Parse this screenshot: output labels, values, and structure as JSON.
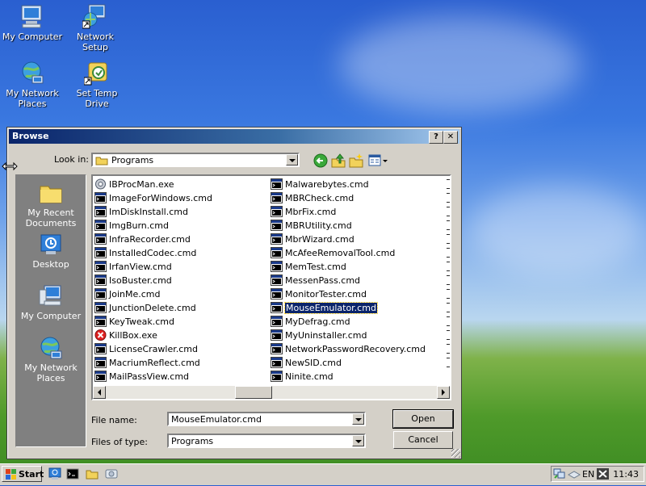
{
  "desktop": {
    "icons": [
      {
        "label": "My Computer"
      },
      {
        "label": "Network Setup"
      },
      {
        "label": "My Network Places"
      },
      {
        "label": "Set Temp Drive"
      }
    ]
  },
  "dialog": {
    "title": "Browse",
    "help_btn": "?",
    "close_btn": "✕",
    "look_in_label": "Look in:",
    "look_in_value": "Programs",
    "places": [
      {
        "label": "My Recent Documents"
      },
      {
        "label": "Desktop"
      },
      {
        "label": "My Computer"
      },
      {
        "label": "My Network Places"
      }
    ],
    "files_col1": [
      "IBProcMan.exe",
      "ImageForWindows.cmd",
      "ImDiskInstall.cmd",
      "ImgBurn.cmd",
      "InfraRecorder.cmd",
      "InstalledCodec.cmd",
      "IrfanView.cmd",
      "IsoBuster.cmd",
      "JoinMe.cmd",
      "JunctionDelete.cmd",
      "KeyTweak.cmd",
      "KillBox.exe",
      "LicenseCrawler.cmd",
      "MacriumReflect.cmd",
      "MailPassView.cmd"
    ],
    "files_col2": [
      "Malwarebytes.cmd",
      "MBRCheck.cmd",
      "MbrFix.cmd",
      "MBRUtility.cmd",
      "MbrWizard.cmd",
      "McAfeeRemovalTool.cmd",
      "MemTest.cmd",
      "MessenPass.cmd",
      "MonitorTester.cmd",
      "MouseEmulator.cmd",
      "MyDefrag.cmd",
      "MyUninstaller.cmd",
      "NetworkPasswordRecovery.cmd",
      "NewSID.cmd",
      "Ninite.cmd"
    ],
    "selected_file": "MouseEmulator.cmd",
    "file_name_label": "File name:",
    "file_name_value": "MouseEmulator.cmd",
    "file_type_label": "Files of type:",
    "file_type_value": "Programs",
    "open_btn": "Open",
    "cancel_btn": "Cancel"
  },
  "taskbar": {
    "start_label": "Start",
    "lang": "EN",
    "clock": "11:43"
  },
  "colors": {
    "titlebar": "#0a246a",
    "selection": "#0a246a",
    "dialog_bg": "#d4d0c8"
  }
}
